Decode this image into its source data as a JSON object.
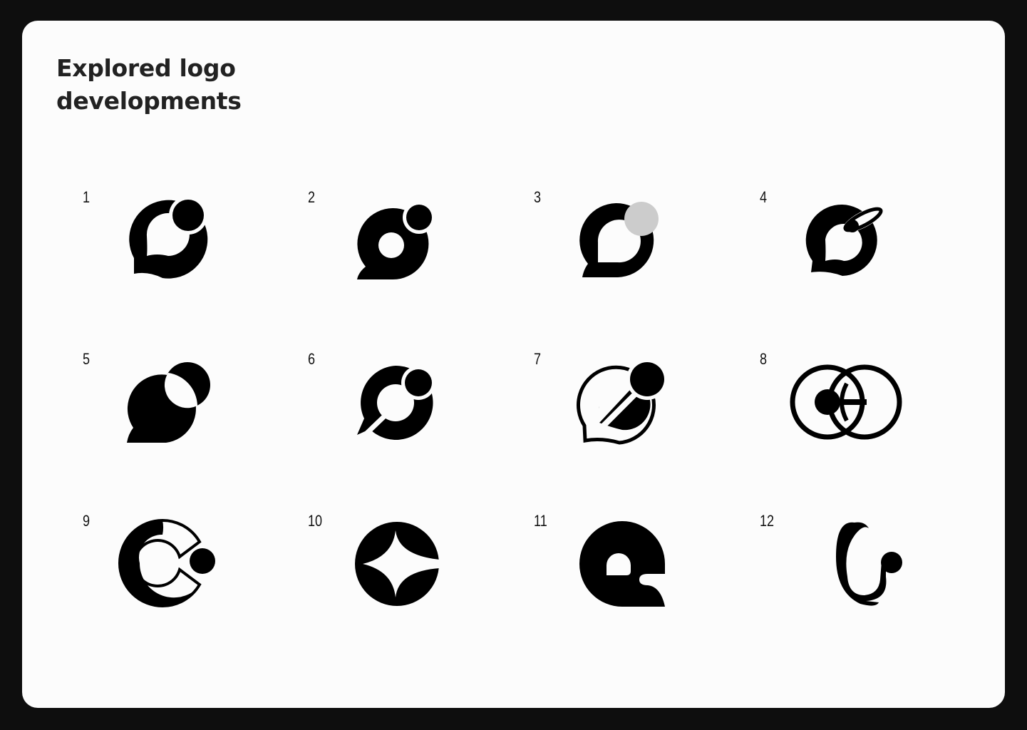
{
  "title": {
    "line1": "Explored logo",
    "line2": "developments"
  },
  "logos": [
    {
      "number": "1"
    },
    {
      "number": "2"
    },
    {
      "number": "3"
    },
    {
      "number": "4"
    },
    {
      "number": "5"
    },
    {
      "number": "6"
    },
    {
      "number": "7"
    },
    {
      "number": "8"
    },
    {
      "number": "9"
    },
    {
      "number": "10"
    },
    {
      "number": "11"
    },
    {
      "number": "12"
    }
  ],
  "colors": {
    "background": "#0e0e0e",
    "card": "#fcfcfc",
    "mark": "#000000",
    "accent_gray": "#cccccc",
    "title": "#222222"
  }
}
